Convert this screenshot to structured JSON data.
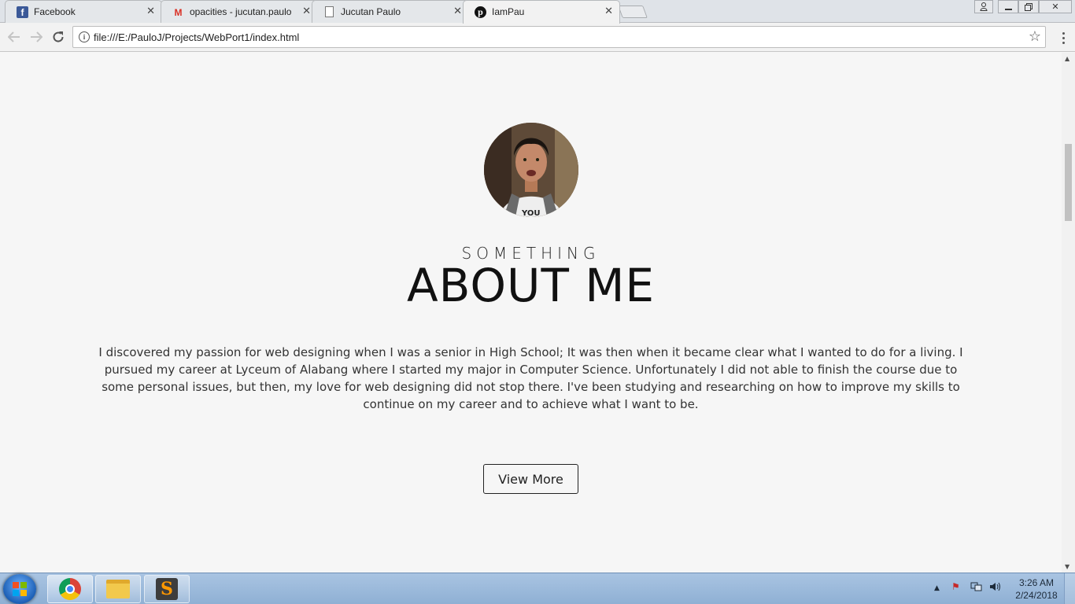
{
  "browser": {
    "tabs": [
      {
        "title": "Facebook",
        "icon": "facebook-icon",
        "active": false
      },
      {
        "title": "opacities - jucutan.paulo",
        "icon": "gmail-icon",
        "active": false
      },
      {
        "title": "Jucutan Paulo",
        "icon": "document-icon",
        "active": false
      },
      {
        "title": "IamPau",
        "icon": "pinterest-icon",
        "active": true
      }
    ],
    "url": "file:///E:/PauloJ/Projects/WebPort1/index.html"
  },
  "page": {
    "subtitle": "SOMETHING",
    "title": "ABOUT ME",
    "paragraph": "I discovered my passion for web designing when I was a senior in High School; It was then when it became clear what I wanted to do for a living. I pursued my career at Lyceum of Alabang where I started my major in Computer Science. Unfortunately I did not able to finish the course due to some personal issues, but then, my love for web designing did not stop there. I've been studying and researching on how to improve my skills to continue on my career and to achieve what I want to be.",
    "button_label": "View More",
    "avatar_alt": "profile-photo"
  },
  "taskbar": {
    "apps": [
      "chrome-icon",
      "file-explorer-icon",
      "sublime-text-icon"
    ],
    "clock_time": "3:26 AM",
    "clock_date": "2/24/2018"
  }
}
